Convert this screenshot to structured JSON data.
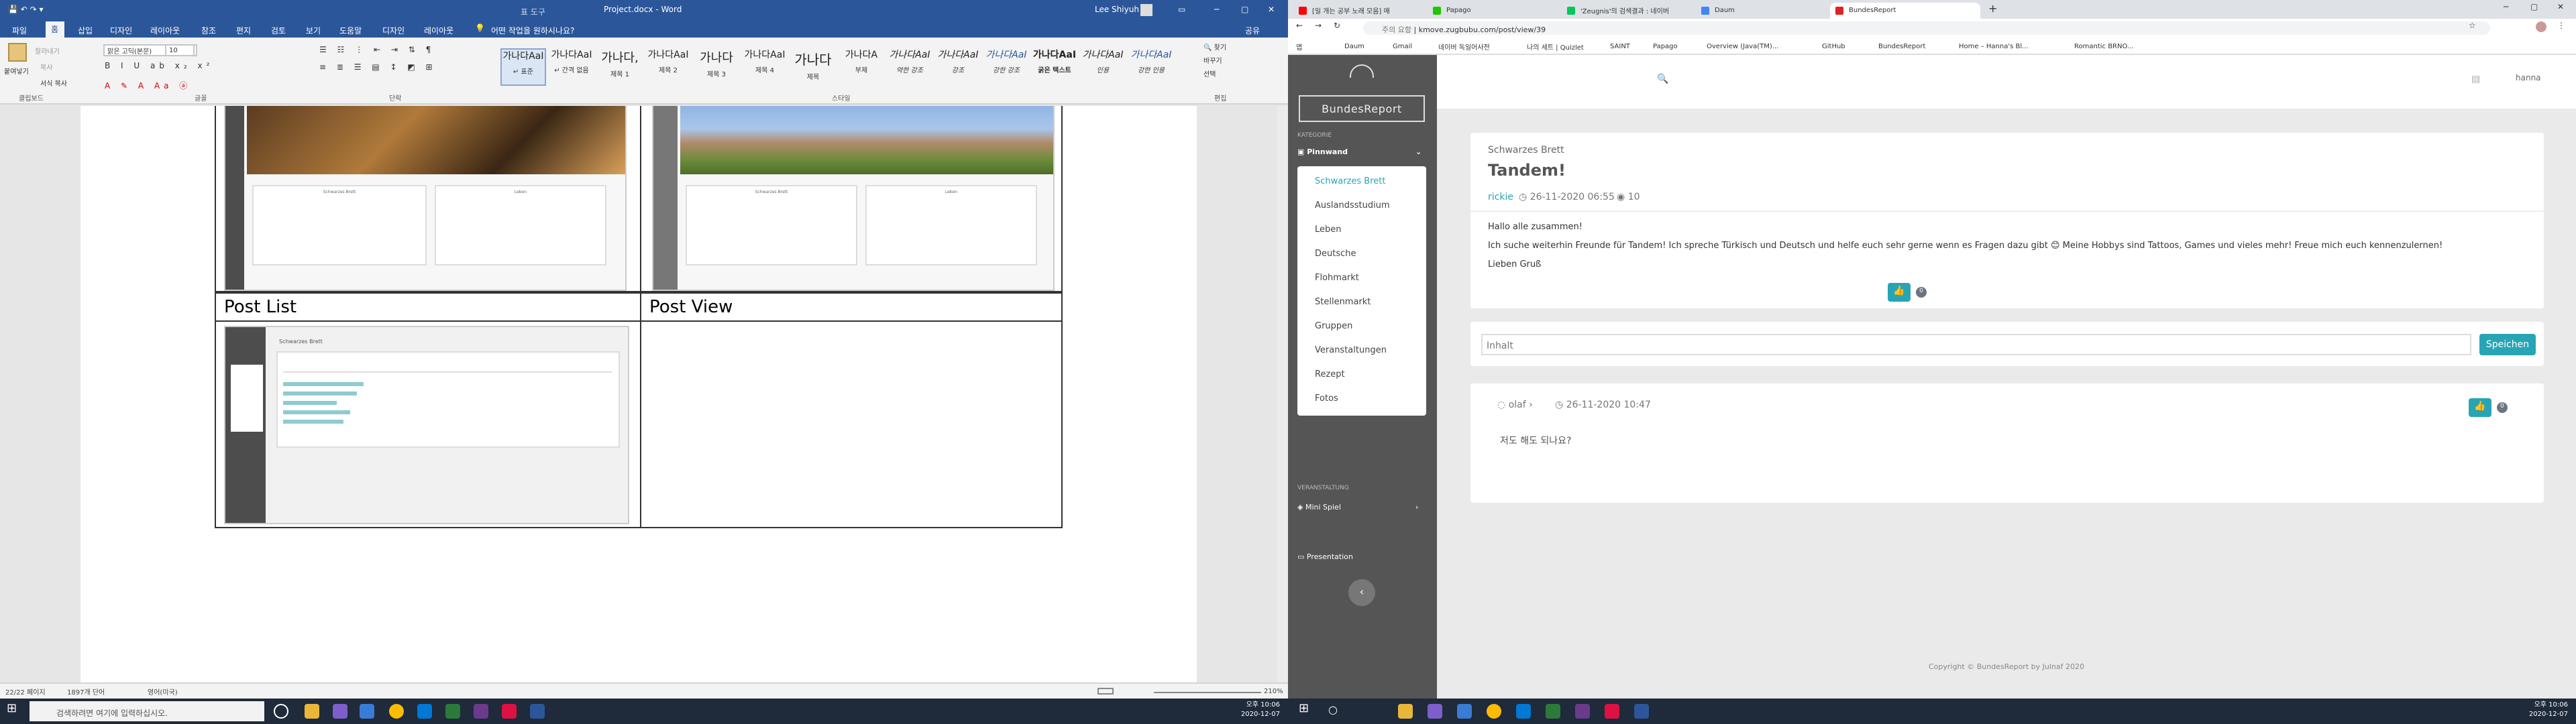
{
  "word": {
    "window_title": "Project.docx - Word",
    "context_tab": "표 도구",
    "user": "Lee Shiyuh",
    "tabs": [
      "파일",
      "홈",
      "삽입",
      "디자인",
      "레이아웃",
      "참조",
      "편지",
      "검토",
      "보기",
      "도움말",
      "디자인",
      "레이아웃"
    ],
    "tell_me": "어떤 작업을 원하시나요?",
    "share": "공유",
    "ribbon": {
      "paste": "붙여넣기",
      "cut": "잘라내기",
      "copy": "복사",
      "format_painter": "서식 복사",
      "font_name": "맑은 고딕(본문)",
      "font_size": "10",
      "groups": [
        "클립보드",
        "글꼴",
        "단락",
        "스타일",
        "편집"
      ],
      "find": "찾기",
      "replace": "바꾸기",
      "select": "선택"
    },
    "styles": [
      {
        "preview": "가나다AaI",
        "label": "↵ 표준"
      },
      {
        "preview": "가나다AaI",
        "label": "↵ 간격 없음"
      },
      {
        "preview": "가나다,",
        "label": "제목 1"
      },
      {
        "preview": "가나다AaI",
        "label": "제목 2"
      },
      {
        "preview": "가나다",
        "label": "제목 3"
      },
      {
        "preview": "가나다AaI",
        "label": "제목 4"
      },
      {
        "preview": "가나다",
        "label": "제목"
      },
      {
        "preview": "가나다A",
        "label": "부제"
      },
      {
        "preview": "가나다AaI",
        "label": "약한 강조"
      },
      {
        "preview": "가나다AaI",
        "label": "강조"
      },
      {
        "preview": "가나다AaI",
        "label": "강한 강조"
      },
      {
        "preview": "가나다AaI",
        "label": "굵은 텍스트"
      },
      {
        "preview": "가나다AaI",
        "label": "인용"
      },
      {
        "preview": "가나다AaI",
        "label": "강한 인용"
      }
    ],
    "table": {
      "post_list": "Post List",
      "post_view": "Post View"
    },
    "thumb": {
      "board_title": "Schwarzes Brett",
      "board_title2": "Leben"
    },
    "status": {
      "page": "22/22 페이지",
      "words": "1897개 단어",
      "lang": "영어(미국)",
      "zoom": "210%"
    }
  },
  "taskbar_left": {
    "search_placeholder": "검색하려면 여기에 입력하십시오.",
    "time": "오후 10:06",
    "date": "2020-12-07"
  },
  "browser": {
    "tabs": [
      {
        "label": "[일 개는 공부 노래 모음] 매",
        "color": "#ff0000"
      },
      {
        "label": "Papago",
        "color": "#1ec800"
      },
      {
        "label": "'Zeugnis'의 검색결과 : 네이버",
        "color": "#03c75a"
      },
      {
        "label": "Daum",
        "color": "#4285f4"
      },
      {
        "label": "BundesReport",
        "color": "#dd2222"
      }
    ],
    "url": "kmove.zugbubu.com/post/view/39",
    "url_prefix": "주의 요함",
    "bookmarks": [
      "앱",
      "Daum",
      "Gmail",
      "네이버 독일어사전",
      "나의 세트 | Quizlet",
      "SAINT",
      "Papago",
      "Overview (Java(TM)...",
      "GitHub",
      "BundesReport",
      "Home – Hanna's Bl...",
      "Romantic BRNO..."
    ]
  },
  "site": {
    "logo": "BundesReport",
    "category_label": "KATEGORIE",
    "pinnwand": "Pinnwand",
    "submenu": [
      "Schwarzes Brett",
      "Auslandsstudium",
      "Leben",
      "Deutsche",
      "Flohmarkt",
      "Stellenmarkt",
      "Gruppen",
      "Veranstaltungen",
      "Rezept",
      "Fotos"
    ],
    "veranstaltung_label": "VERANSTALTUNG",
    "mini_spiel": "Mini Spiel",
    "presentation": "Presentation",
    "user": "hanna",
    "post": {
      "category": "Schwarzes Brett",
      "title": "Tandem!",
      "author": "rickie",
      "date": "26-11-2020 06:55",
      "views": "10",
      "line1": "Hallo alle zusammen!",
      "line2": "Ich suche weiterhin Freunde für Tandem! Ich spreche Türkisch und Deutsch und helfe euch sehr gerne wenn es Fragen dazu gibt 😊 Meine Hobbys sind Tattoos, Games und vieles mehr! Freue mich euch kennenzulernen!",
      "line3": "Lieben Gruß",
      "likes": "0"
    },
    "comment_form": {
      "placeholder": "Inhalt",
      "save": "Speichen"
    },
    "comment": {
      "author": "olaf",
      "date": "26-11-2020 10:47",
      "text": "저도 해도 되나요?",
      "likes": "0"
    },
    "footer": "Copyright © BundesReport by Julnaf 2020"
  },
  "taskbar_right": {
    "time": "오후 10:06",
    "date": "2020-12-07"
  }
}
